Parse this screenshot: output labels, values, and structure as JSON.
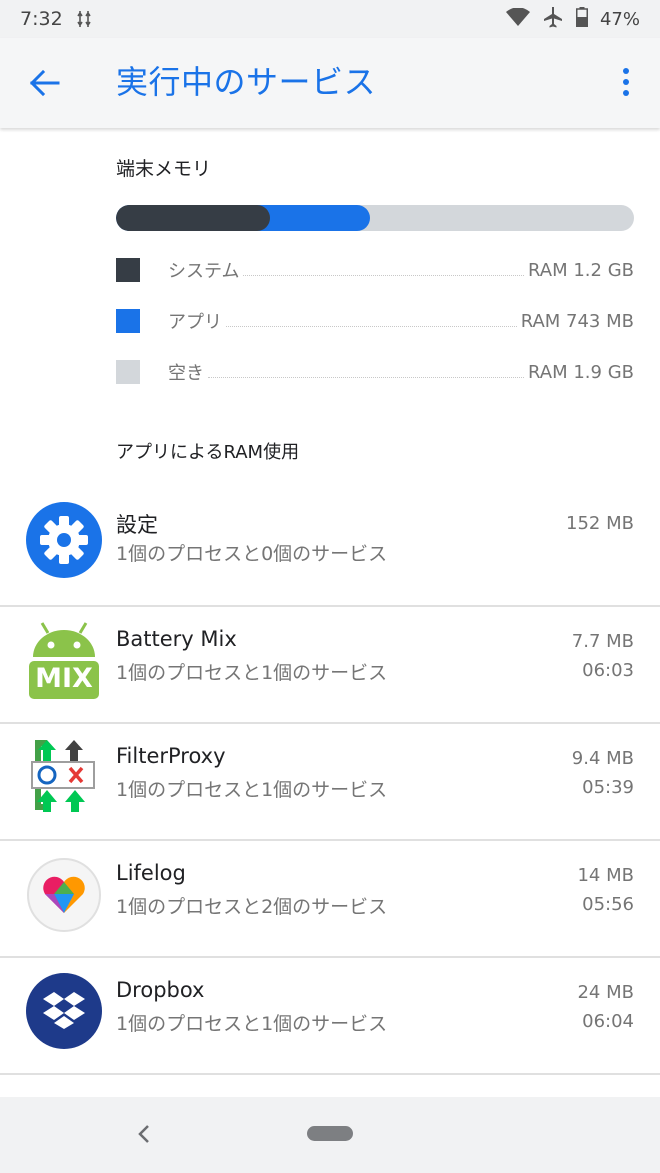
{
  "status_bar": {
    "time": "7:32",
    "battery": "47%"
  },
  "app_bar": {
    "title": "実行中のサービス"
  },
  "memory": {
    "heading": "端末メモリ",
    "system_fraction": 0.297,
    "app_fraction": 0.49,
    "legend": [
      {
        "label": "システム",
        "value": "RAM 1.2 GB",
        "color": "#363d45"
      },
      {
        "label": "アプリ",
        "value": "RAM 743 MB",
        "color": "#1a73e8"
      },
      {
        "label": "空き",
        "value": "RAM 1.9 GB",
        "color": "#d3d7db"
      }
    ]
  },
  "usage_heading": "アプリによるRAM使用",
  "apps": [
    {
      "name": "設定",
      "desc": "1個のプロセスと0個のサービス",
      "size": "152 MB",
      "time": "",
      "icon": "settings-gear-icon"
    },
    {
      "name": "Battery Mix",
      "desc": "1個のプロセスと1個のサービス",
      "size": "7.7 MB",
      "time": "06:03",
      "icon": "battery-mix-android-icon",
      "icon_text": "MIX"
    },
    {
      "name": "FilterProxy",
      "desc": "1個のプロセスと1個のサービス",
      "size": "9.4 MB",
      "time": "05:39",
      "icon": "filterproxy-icon"
    },
    {
      "name": "Lifelog",
      "desc": "1個のプロセスと2個のサービス",
      "size": "14 MB",
      "time": "05:56",
      "icon": "lifelog-heart-icon"
    },
    {
      "name": "Dropbox",
      "desc": "1個のプロセスと1個のサービス",
      "size": "24 MB",
      "time": "06:04",
      "icon": "dropbox-icon"
    }
  ],
  "colors": {
    "accent": "#1a73e8",
    "android_green": "#8bc34a",
    "dropbox_navy": "#1e3a8a"
  }
}
